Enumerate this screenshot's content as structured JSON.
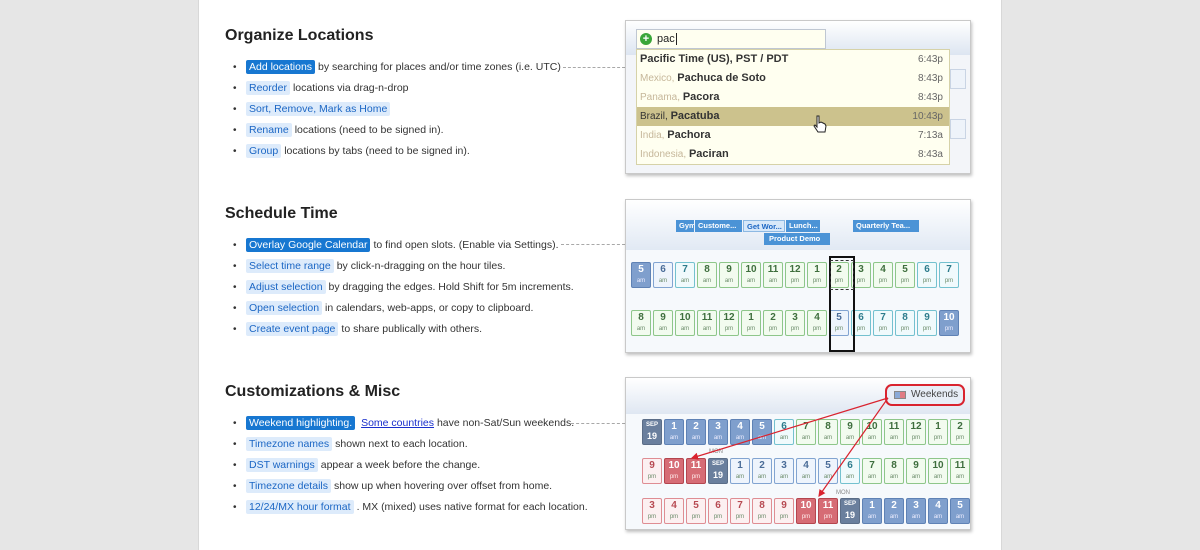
{
  "sections": [
    {
      "title": "Organize Locations",
      "items": [
        {
          "tag": "Add locations",
          "primary": true,
          "text": "by searching for places and/or time zones (i.e. UTC)"
        },
        {
          "tag": "Reorder",
          "text": "locations via drag-n-drop"
        },
        {
          "tag": "Sort, Remove, Mark as Home",
          "text": ""
        },
        {
          "tag": "Rename",
          "text": "locations (need to be signed in)."
        },
        {
          "tag": "Group",
          "text": "locations by tabs (need to be signed in)."
        }
      ]
    },
    {
      "title": "Schedule Time",
      "items": [
        {
          "tag": "Overlay Google Calendar",
          "primary": true,
          "text": "to find open slots. (Enable via Settings)."
        },
        {
          "tag": "Select time range",
          "text": "by click-n-dragging on the hour tiles."
        },
        {
          "tag": "Adjust selection",
          "text": "by dragging the edges. Hold Shift for 5m increments."
        },
        {
          "tag": "Open selection",
          "text": "in calendars, web-apps, or copy to clipboard."
        },
        {
          "tag": "Create event page",
          "text": "to share publically with others."
        }
      ]
    },
    {
      "title": "Customizations & Misc",
      "items": [
        {
          "tag": "Weekend highlighting.",
          "primary": true,
          "link": "Some countries",
          "text": "have non-Sat/Sun weekends."
        },
        {
          "tag": "Timezone names",
          "text": "shown next to each location."
        },
        {
          "tag": "DST warnings",
          "text": "appear a week before the change."
        },
        {
          "tag": "Timezone details",
          "text": "show up when hovering over offset from home."
        },
        {
          "tag": "12/24/MX hour format",
          "text": ". MX (mixed) uses native format for each location."
        }
      ]
    }
  ],
  "search": {
    "query": "pac",
    "results": [
      {
        "prefix": "",
        "name": "Pacific Time (US), PST / PDT",
        "time": "6:43p"
      },
      {
        "prefix": "Mexico, ",
        "name": "Pachuca de Soto",
        "time": "8:43p"
      },
      {
        "prefix": "Panama, ",
        "name": "Pacora",
        "time": "8:43p"
      },
      {
        "prefix": "Brazil, ",
        "name": "Pacatuba",
        "time": "10:43p",
        "highlighted": true
      },
      {
        "prefix": "India, ",
        "name": "Pachora",
        "time": "7:13a"
      },
      {
        "prefix": "Indonesia, ",
        "name": "Paciran",
        "time": "8:43a"
      }
    ]
  },
  "events": [
    "Gym",
    "Custome...",
    "Get Wor...",
    "Lunch...",
    "Quarterly Tea...",
    "Product Demo"
  ],
  "schedule_rows": [
    {
      "hours": [
        "5",
        "6",
        "7",
        "8",
        "9",
        "10",
        "11",
        "12",
        "1",
        "2",
        "3",
        "4",
        "5",
        "6",
        "7"
      ],
      "subs": [
        "am",
        "am",
        "am",
        "am",
        "am",
        "am",
        "am",
        "pm",
        "pm",
        "pm",
        "pm",
        "pm",
        "pm",
        "pm",
        "pm"
      ]
    },
    {
      "hours": [
        "8",
        "9",
        "10",
        "11",
        "12",
        "1",
        "2",
        "3",
        "4",
        "5",
        "6",
        "7",
        "8",
        "9",
        "10"
      ],
      "subs": [
        "am",
        "am",
        "am",
        "am",
        "pm",
        "pm",
        "pm",
        "pm",
        "pm",
        "pm",
        "pm",
        "pm",
        "pm",
        "pm",
        "pm"
      ]
    }
  ],
  "weekends": {
    "toggle_label": "Weekends",
    "month_label": "SEP",
    "day_label": "19",
    "mon_label": "MON",
    "rows": [
      {
        "hours": [
          "SEP",
          "1",
          "2",
          "3",
          "4",
          "5",
          "6",
          "7",
          "8",
          "9",
          "10",
          "11",
          "12",
          "1",
          "2"
        ],
        "subs": [
          "19",
          "am",
          "am",
          "am",
          "am",
          "am",
          "am",
          "am",
          "am",
          "am",
          "am",
          "am",
          "pm",
          "pm",
          "pm"
        ]
      },
      {
        "hours": [
          "9",
          "10",
          "11",
          "SEP",
          "1",
          "2",
          "3",
          "4",
          "5",
          "6",
          "7",
          "8",
          "9",
          "10",
          "11"
        ],
        "subs": [
          "pm",
          "pm",
          "pm",
          "19",
          "am",
          "am",
          "am",
          "am",
          "am",
          "am",
          "am",
          "am",
          "am",
          "am",
          "am"
        ]
      },
      {
        "hours": [
          "3",
          "4",
          "5",
          "6",
          "7",
          "8",
          "9",
          "10",
          "11",
          "SEP",
          "1",
          "2",
          "3",
          "4",
          "5"
        ],
        "subs": [
          "pm",
          "pm",
          "pm",
          "pm",
          "pm",
          "pm",
          "pm",
          "pm",
          "pm",
          "19",
          "am",
          "am",
          "am",
          "am",
          "am"
        ]
      }
    ]
  },
  "colors": {
    "accent": "#1777d1",
    "tag_bg": "#ddebfb",
    "weekend_red": "#d9232f"
  }
}
